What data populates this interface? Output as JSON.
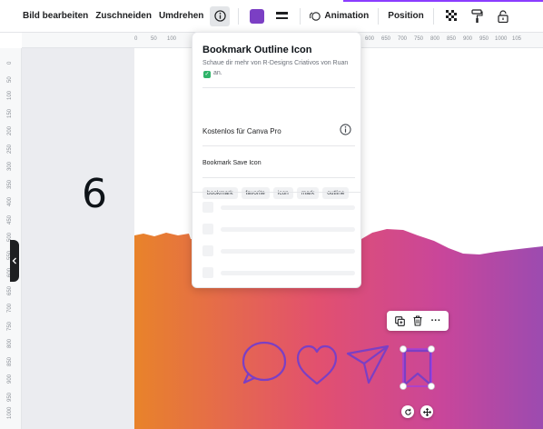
{
  "toolbar": {
    "edit_image_label": "Bild bearbeiten",
    "crop_label": "Zuschneiden",
    "flip_label": "Umdrehen",
    "color_swatch": "#7b3fc4",
    "animation_label": "Animation",
    "position_label": "Position",
    "accent_color": "#8b3dff"
  },
  "ruler_top": [
    "0",
    "50",
    "100",
    "600",
    "650",
    "700",
    "750",
    "800",
    "850",
    "900",
    "950",
    "1000",
    "105"
  ],
  "ruler_left": [
    "0",
    "50",
    "100",
    "150",
    "200",
    "250",
    "300",
    "350",
    "400",
    "450",
    "500",
    "550",
    "600",
    "650",
    "700",
    "750",
    "800",
    "850",
    "900",
    "950",
    "1000",
    "10"
  ],
  "canvas": {
    "page_number": "6",
    "gradient_colors": [
      "#e8832a",
      "#e2506f",
      "#c9469a",
      "#9c4bb0"
    ],
    "icon_stroke_color": "#7b3fc4",
    "icons": [
      "speech-bubble-icon",
      "heart-icon",
      "send-icon",
      "bookmark-icon"
    ]
  },
  "info_popover": {
    "title": "Bookmark Outline Icon",
    "subtitle_prefix": "Schaue dir mehr von R-Designs Criativos von Ruan",
    "subtitle_suffix": "an.",
    "pro_label": "Kostenlos für Canva Pro",
    "element_name": "Bookmark Save Icon",
    "tags": [
      "bookmark",
      "favorite",
      "icon",
      "mark",
      "outline"
    ]
  },
  "element_toolbar": {
    "more_label": "···"
  }
}
